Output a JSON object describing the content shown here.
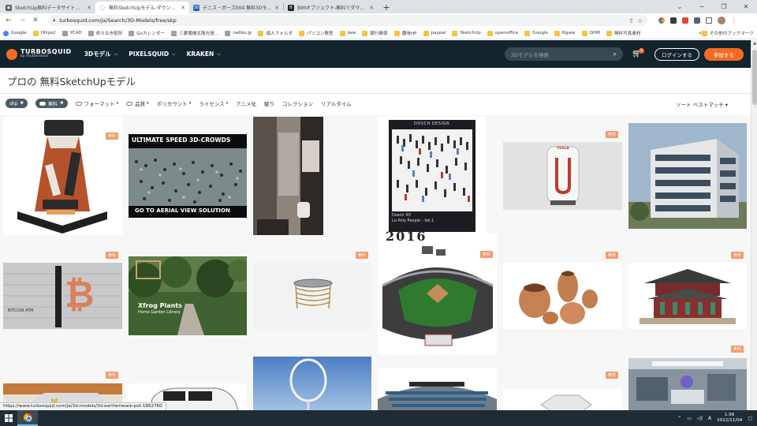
{
  "browser": {
    "tabs": [
      {
        "title": "SketchUp無料データサイト一覧 - jw",
        "color": "#5f6368",
        "active": false
      },
      {
        "title": "無料SketchUpモデル-ダウンロード-Sketc",
        "color": "#1a73e8",
        "active": true
      },
      {
        "title": "デニス・ボーズ004 無料3Dモデル - .",
        "color": "#1565c0",
        "active": false
      },
      {
        "title": "BIMオブジェクト-無料でダウンロード",
        "color": "#202124",
        "active": false
      }
    ],
    "new_tab_symbol": "+",
    "url": "turbosquid.com/ja/Search/3D-Models/free/skp",
    "bookmarks": [
      {
        "label": "Google",
        "icon": "google"
      },
      {
        "label": "Https//",
        "icon": "folder"
      },
      {
        "label": "YCAD",
        "icon": "site"
      },
      {
        "label": "県々丘市役所",
        "icon": "site"
      },
      {
        "label": "Goカレンダー",
        "icon": "site"
      },
      {
        "label": "三菱電機太陽光発…",
        "icon": "site"
      },
      {
        "label": "radiko.jp",
        "icon": "site"
      },
      {
        "label": "個人フォルダ",
        "icon": "folder"
      },
      {
        "label": "パソコン教室",
        "icon": "folder"
      },
      {
        "label": "jww",
        "icon": "folder"
      },
      {
        "label": "銀行関係",
        "icon": "folder"
      },
      {
        "label": "趣味HP",
        "icon": "folder"
      },
      {
        "label": "paypal",
        "icon": "folder"
      },
      {
        "label": "SketchUp",
        "icon": "folder"
      },
      {
        "label": "openoffice",
        "icon": "folder"
      },
      {
        "label": "Google",
        "icon": "folder"
      },
      {
        "label": "Rgww",
        "icon": "folder"
      },
      {
        "label": "QHM",
        "icon": "folder"
      },
      {
        "label": "無料写真素材",
        "icon": "folder"
      }
    ],
    "bookmarks_more": "»",
    "other_bookmarks": "その他のブックマーク",
    "status_url": "https://www.turbosquid.com/ja/3d-models/3d-earthenware-pot-1862760"
  },
  "site": {
    "logo_line1": "TURBOSQUID",
    "logo_line2": "by shutterstock",
    "nav": [
      {
        "label": "3Dモデル"
      },
      {
        "label": "PIXELSQUID"
      },
      {
        "label": "KRAKEN"
      }
    ],
    "search_placeholder": "3Dモデルを検索",
    "cart_count": "0",
    "login_label": "ログインする",
    "signup_label": "参加する",
    "accent": "#f36b24",
    "header_bg": "#13242c"
  },
  "page": {
    "title": "プロの 無料SketchUpモデル",
    "active_chips": [
      {
        "label": "skp",
        "toggle": false
      },
      {
        "label": "無料",
        "toggle": true
      }
    ],
    "filters": [
      {
        "label": "フォーマット",
        "toggle": true,
        "arrow": true
      },
      {
        "label": "品質",
        "toggle": true,
        "arrow": true
      },
      {
        "label": "ポリカウント",
        "toggle": false,
        "arrow": true
      },
      {
        "label": "ライセンス",
        "toggle": false,
        "arrow": true
      },
      {
        "label": "アニメ化",
        "toggle": false,
        "arrow": false
      },
      {
        "label": "駆り",
        "toggle": false,
        "arrow": false
      },
      {
        "label": "コレクション",
        "toggle": false,
        "arrow": false
      },
      {
        "label": "リアルタイム",
        "toggle": false,
        "arrow": false
      }
    ],
    "sort_label": "ソート ベストマッチ",
    "free_badge": "無料"
  },
  "grid": {
    "items": [
      {
        "name": "edition-tower",
        "badge": true
      },
      {
        "name": "3d-crowds",
        "badge": false,
        "banner_top": "ULTIMATE SPEED 3D-CROWDS",
        "banner_bottom": "GO TO AERIAL VIEW SOLUTION"
      },
      {
        "name": "bathroom-interior",
        "badge": true
      },
      {
        "name": "dosch-lowpoly-people",
        "badge": false,
        "box_brand": "DOSCH DESIGN",
        "box_title": "Dosch 3D",
        "box_sub": "Lo-Poly People - Vol.1"
      },
      {
        "name": "tesla-supercharger",
        "badge": true,
        "brand": "TESLA"
      },
      {
        "name": "modern-building",
        "badge": false
      },
      {
        "name": "bitcoin-sign",
        "badge": true,
        "caption": "BITCOIN ATM"
      },
      {
        "name": "xfrog-plants",
        "badge": false,
        "caption_title": "Xfrog Plants",
        "caption_sub": "Home Garden Library"
      },
      {
        "name": "round-table",
        "badge": true
      },
      {
        "name": "stadium-2016",
        "badge": true,
        "caption_title": "2016"
      },
      {
        "name": "earthenware-pots",
        "badge": true
      },
      {
        "name": "korean-temple",
        "badge": true
      },
      {
        "name": "mcdonalds-board",
        "badge": true
      },
      {
        "name": "white-suv",
        "badge": false
      },
      {
        "name": "ring-sculpture",
        "badge": false
      },
      {
        "name": "stadium-2",
        "badge": false
      },
      {
        "name": "white-box",
        "badge": true
      },
      {
        "name": "hospital-room",
        "badge": true
      }
    ]
  },
  "taskbar": {
    "time": "1:56",
    "date": "2022/11/04",
    "ime": "A"
  }
}
